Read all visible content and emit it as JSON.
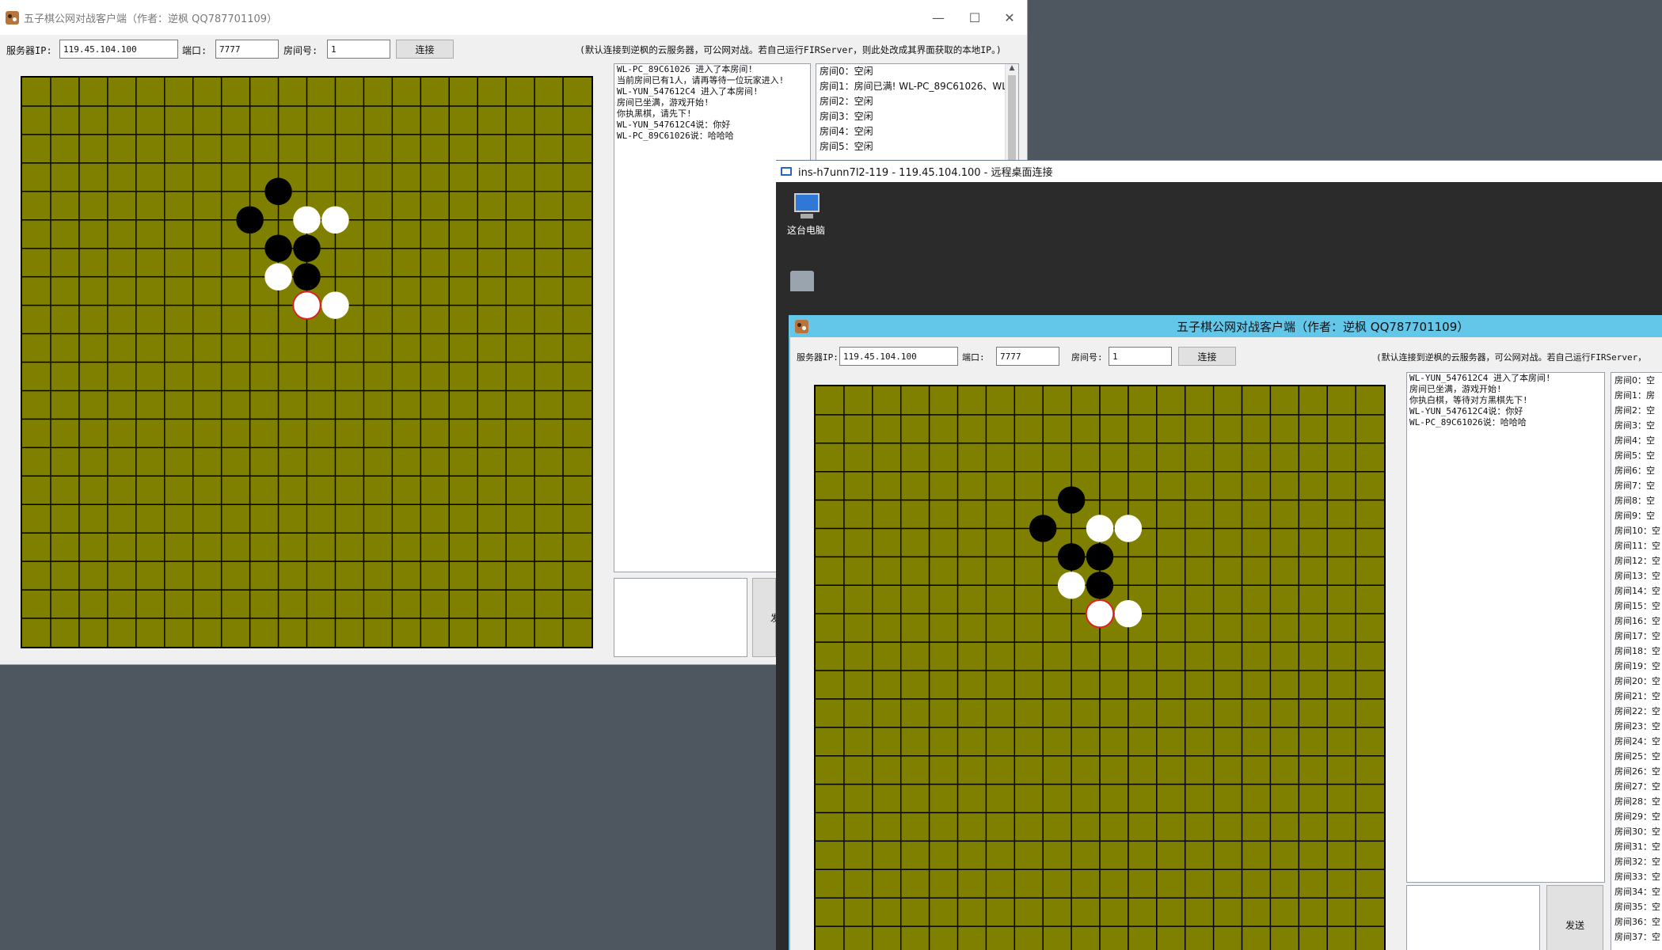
{
  "local_window": {
    "title": "五子棋公网对战客户端（作者：逆枫 QQ787701109）",
    "minimize_glyph": "—",
    "maximize_glyph": "☐",
    "close_glyph": "✕",
    "server_ip_label": "服务器IP:",
    "server_ip_value": "119.45.104.100",
    "port_label": "端口:",
    "port_value": "7777",
    "room_label": "房间号:",
    "room_value": "1",
    "connect_label": "连接",
    "hint": "(默认连接到逆枫的云服务器，可公网对战。若自己运行FIRServer，则此处改成其界面获取的本地IP。)",
    "log": [
      "WL-PC_89C61026 进入了本房间!",
      "当前房间已有1人，请再等待一位玩家进入!",
      "WL-YUN_547612C4 进入了本房间!",
      "房间已坐满，游戏开始!",
      "你执黑棋，请先下!",
      "WL-YUN_547612C4说：你好",
      "WL-PC_89C61026说：哈哈哈"
    ],
    "rooms": [
      "房间0：空闲",
      "房间1：房间已满! WL-PC_89C61026、WL",
      "房间2：空闲",
      "房间3：空闲",
      "房间4：空闲",
      "房间5：空闲"
    ],
    "send_label": "发"
  },
  "remote_window": {
    "rdp_title": "ins-h7unn7l2-119 - 119.45.104.100 - 远程桌面连接",
    "desktop_icon_label": "这台电脑",
    "title": "五子棋公网对战客户端（作者：逆枫 QQ787701109）",
    "server_ip_label": "服务器IP:",
    "server_ip_value": "119.45.104.100",
    "port_label": "端口:",
    "port_value": "7777",
    "room_label": "房间号:",
    "room_value": "1",
    "connect_label": "连接",
    "hint": "(默认连接到逆枫的云服务器，可公网对战。若自己运行FIRServer，",
    "log": [
      "WL-YUN_547612C4 进入了本房间!",
      "房间已坐满，游戏开始!",
      "你执白棋，等待对方黑棋先下!",
      "WL-YUN_547612C4说：你好",
      "WL-PC_89C61026说：哈哈哈"
    ],
    "rooms": [
      "房间0：空",
      "房间1：房",
      "房间2：空",
      "房间3：空",
      "房间4：空",
      "房间5：空",
      "房间6：空",
      "房间7：空",
      "房间8：空",
      "房间9：空",
      "房间10：空",
      "房间11：空",
      "房间12：空",
      "房间13：空",
      "房间14：空",
      "房间15：空",
      "房间16：空",
      "房间17：空",
      "房间18：空",
      "房间19：空",
      "房间20：空",
      "房间21：空",
      "房间22：空",
      "房间23：空",
      "房间24：空",
      "房间25：空",
      "房间26：空",
      "房间27：空",
      "房间28：空",
      "房间29：空",
      "房间30：空",
      "房间31：空",
      "房间32：空",
      "房间33：空",
      "房间34：空",
      "房间35：空",
      "房间36：空",
      "房间37：空"
    ],
    "send_label": "发送"
  },
  "board": {
    "size": 20,
    "board_color": "#808000",
    "stones": [
      {
        "c": 9,
        "r": 4,
        "color": "black"
      },
      {
        "c": 8,
        "r": 5,
        "color": "black"
      },
      {
        "c": 10,
        "r": 5,
        "color": "white"
      },
      {
        "c": 11,
        "r": 5,
        "color": "white"
      },
      {
        "c": 9,
        "r": 6,
        "color": "black"
      },
      {
        "c": 10,
        "r": 6,
        "color": "black"
      },
      {
        "c": 9,
        "r": 7,
        "color": "white"
      },
      {
        "c": 10,
        "r": 7,
        "color": "black"
      },
      {
        "c": 10,
        "r": 8,
        "color": "white",
        "last": true
      },
      {
        "c": 11,
        "r": 8,
        "color": "white"
      }
    ]
  }
}
